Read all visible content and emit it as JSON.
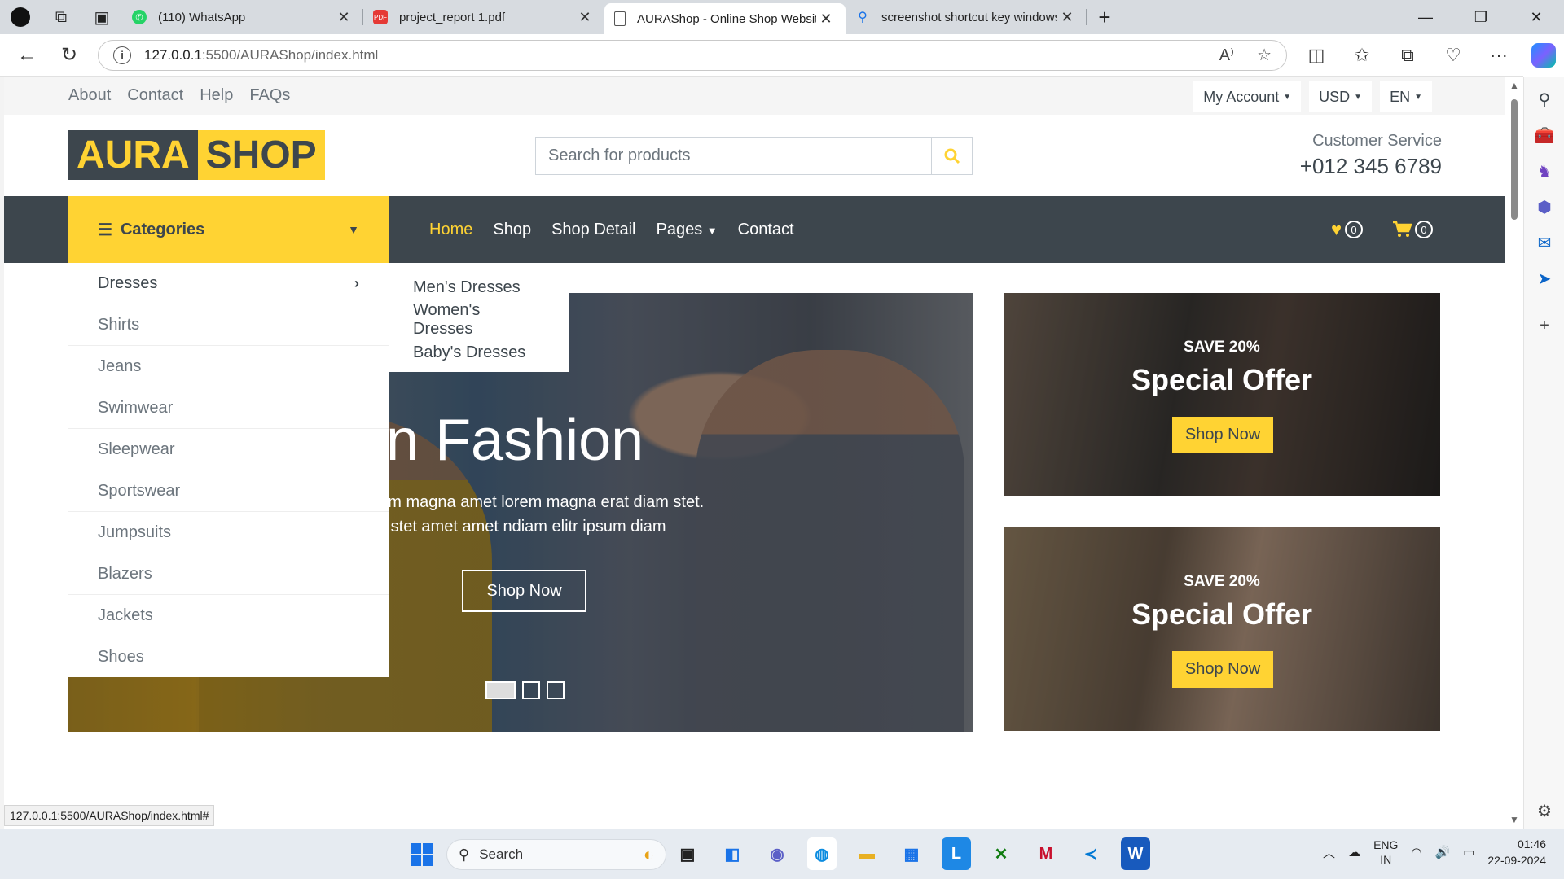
{
  "browser": {
    "tabs": [
      {
        "title": "(110) WhatsApp",
        "icon": "whatsapp-icon",
        "color": "#25d366"
      },
      {
        "title": "project_report 1.pdf",
        "icon": "pdf-icon",
        "color": "#e53935"
      },
      {
        "title": "AURAShop - Online Shop Website",
        "icon": "page-icon",
        "color": "#555555"
      },
      {
        "title": "screenshot shortcut key windows",
        "icon": "search-icon",
        "color": "#1a73e8"
      }
    ],
    "url_host": "127.0.0.1",
    "url_path": ":5500/AURAShop/index.html",
    "status_url": "127.0.0.1:5500/AURAShop/index.html#"
  },
  "site": {
    "top_links": [
      "About",
      "Contact",
      "Help",
      "FAQs"
    ],
    "top_dropdowns": [
      "My Account",
      "USD",
      "EN"
    ],
    "logo": {
      "part1": "AURA",
      "part2": " SHOP"
    },
    "search_placeholder": "Search for products",
    "customer_service": {
      "label": "Customer Service",
      "phone": "+012 345 6789"
    },
    "categories_label": "Categories",
    "nav_links": [
      "Home",
      "Shop",
      "Shop Detail",
      "Pages",
      "Contact"
    ],
    "wishlist_count": "0",
    "cart_count": "0",
    "categories": [
      "Dresses",
      "Shirts",
      "Jeans",
      "Swimwear",
      "Sleepwear",
      "Sportswear",
      "Jumpsuits",
      "Blazers",
      "Jackets",
      "Shoes"
    ],
    "submenu": [
      "Men's Dresses",
      "Women's Dresses",
      "Baby's Dresses"
    ],
    "hero": {
      "title": "Men Fashion",
      "text": "Lorem rebum magna amet lorem magna erat diam stet. Sadips duo stet amet amet ndiam elitr ipsum diam",
      "button": "Shop Now",
      "slides_total": 3,
      "slide_active": 1
    },
    "offers": [
      {
        "save": "SAVE 20%",
        "title": "Special Offer",
        "button": "Shop Now"
      },
      {
        "save": "SAVE 20%",
        "title": "Special Offer",
        "button": "Shop Now"
      }
    ],
    "colors": {
      "accent": "#ffd333",
      "dark": "#3d464d"
    }
  },
  "taskbar": {
    "search_label": "Search",
    "lang": [
      "ENG",
      "IN"
    ],
    "time": "01:46",
    "date": "22-09-2024"
  }
}
